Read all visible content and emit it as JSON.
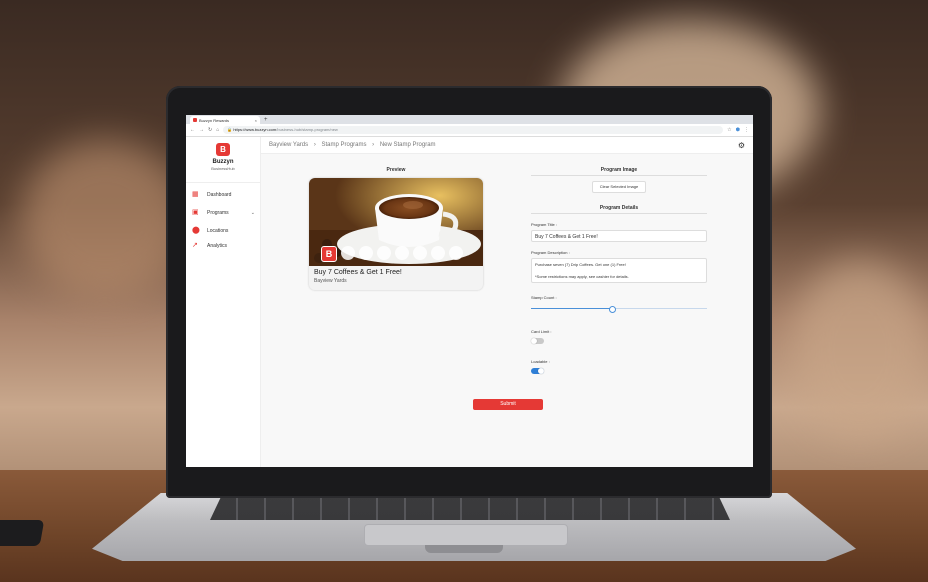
{
  "browser": {
    "tab_title": "Buzzyn Rewards",
    "new_tab": "+",
    "url_host": "https://www.buzzyn.com",
    "url_path": "/business-hub/stamp-program/new"
  },
  "sidebar": {
    "brand": "Buzzyn",
    "brand_sub": "BusinessHub",
    "items": [
      {
        "label": "Dashboard",
        "icon": "dashboard-icon"
      },
      {
        "label": "Programs",
        "icon": "programs-icon"
      },
      {
        "label": "Locations",
        "icon": "location-pin-icon"
      },
      {
        "label": "Analytics",
        "icon": "analytics-chart-icon"
      }
    ]
  },
  "breadcrumb": {
    "items": [
      "Bayview Yards",
      "›",
      "Stamp Programs",
      "›",
      "New Stamp Program"
    ]
  },
  "preview": {
    "heading": "Preview",
    "card_title": "Buy 7 Coffees & Get 1 Free!",
    "card_location": "Bayview Yards",
    "stamp_count": 7
  },
  "form": {
    "image_heading": "Program Image",
    "clear_image": "Clear Selected Image",
    "details_heading": "Program Details",
    "title_label": "Program Title :",
    "title_value": "Buy 7 Coffees & Get 1 Free!",
    "desc_label": "Program Description :",
    "desc_line1": "Purchase seven (7) Drip Coffees. Get one (1) Free!",
    "desc_line2": "*Some restrictions may apply, see cashier for details.",
    "stamp_label": "Stamp Count :",
    "stamp_fraction": 0.46,
    "card_limit_label": "Card Limit :",
    "card_limit_on": false,
    "loadable_label": "Loadable :",
    "loadable_on": true,
    "submit": "Submit"
  },
  "colors": {
    "brand_red": "#e53935",
    "toggle_on": "#2f7fd6",
    "toggle_off": "#c9c9c9",
    "slider": "#4a90d9"
  }
}
